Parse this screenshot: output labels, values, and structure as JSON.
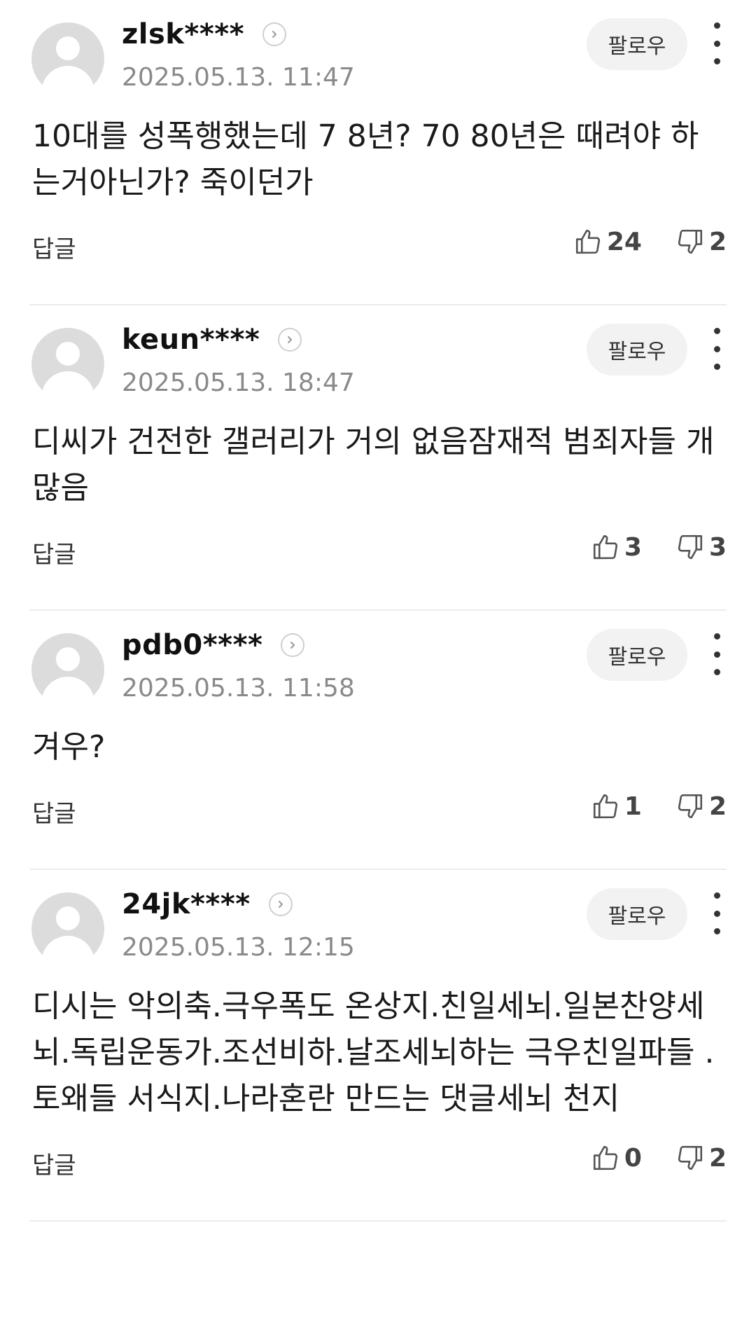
{
  "follow_label": "팔로우",
  "reply_label": "답글",
  "comments": [
    {
      "nickname": "zlsk****",
      "date": "2025.05.13. 11:47",
      "text": "10대를 성폭행했는데 7 8년? 70 80년은 때려야 하는거아닌가? 죽이던가",
      "likes": "24",
      "dislikes": "2"
    },
    {
      "nickname": "keun****",
      "date": "2025.05.13. 18:47",
      "text": "디씨가 건전한 갤러리가 거의 없음잠재적 범죄자들 개많음",
      "likes": "3",
      "dislikes": "3"
    },
    {
      "nickname": "pdb0****",
      "date": "2025.05.13. 11:58",
      "text": "겨우?",
      "likes": "1",
      "dislikes": "2"
    },
    {
      "nickname": "24jk****",
      "date": "2025.05.13. 12:15",
      "text": "디시는 악의축.극우폭도 온상지.친일세뇌.일본찬양세뇌.독립운동가.조선비하.날조세뇌하는 극우친일파들 .토왜들 서식지.나라혼란 만드는 댓글세뇌 천지",
      "likes": "0",
      "dislikes": "2"
    }
  ]
}
